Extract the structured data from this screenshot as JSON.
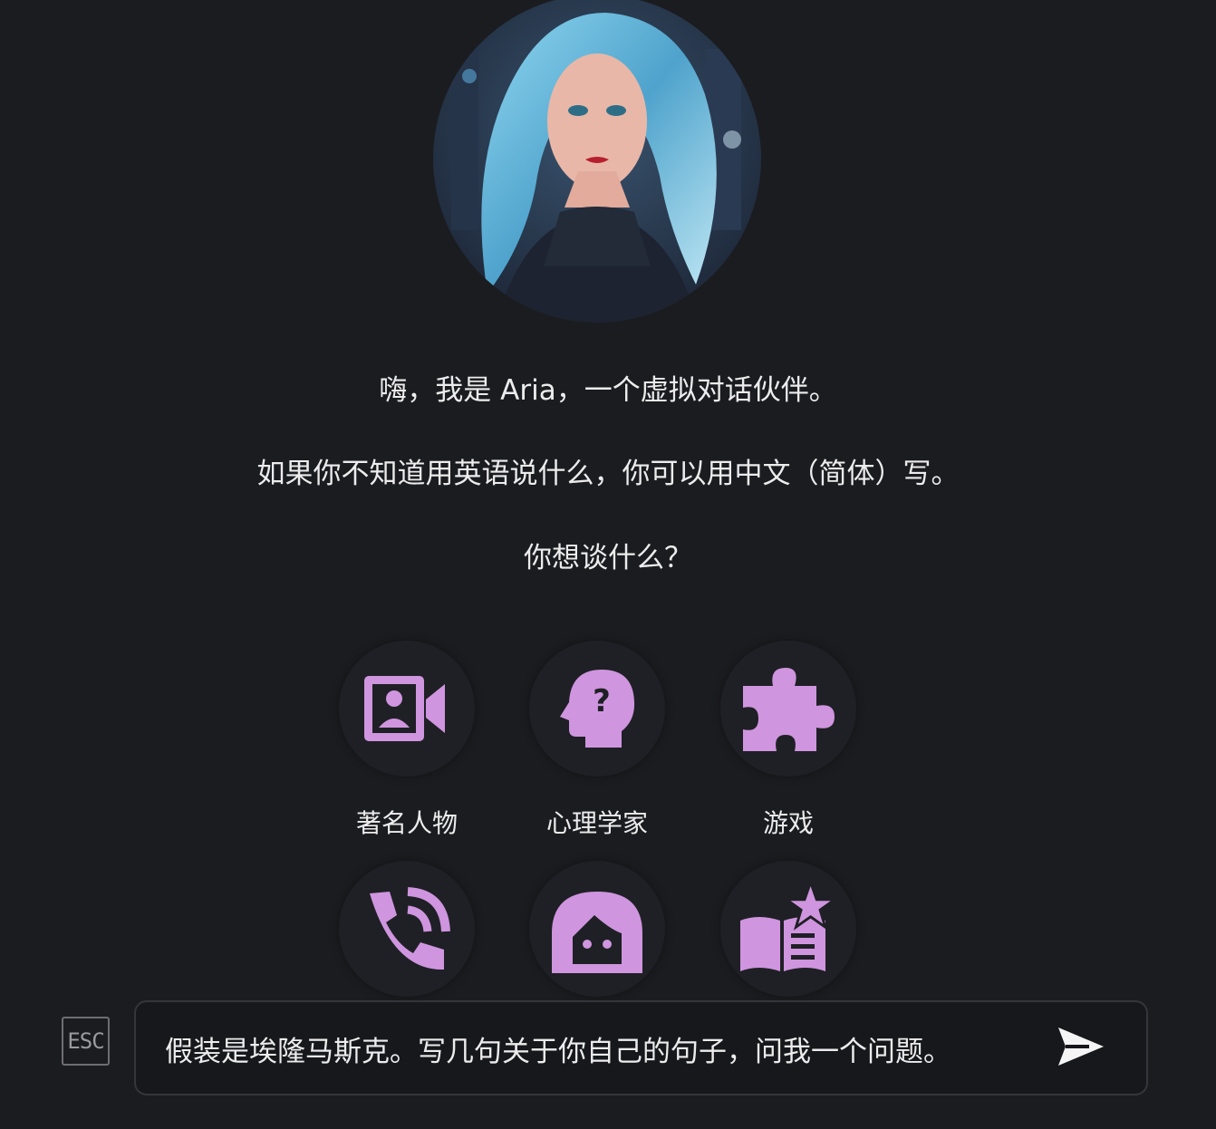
{
  "intro": {
    "greeting": "嗨，我是 Aria，一个虚拟对话伙伴。",
    "language_hint": "如果你不知道用英语说什么，你可以用中文（简体）写。",
    "question": "你想谈什么？"
  },
  "topics": [
    {
      "label": "著名人物",
      "icon": "contact-video-icon"
    },
    {
      "label": "心理学家",
      "icon": "head-question-icon"
    },
    {
      "label": "游戏",
      "icon": "puzzle-icon"
    },
    {
      "label": "",
      "icon": "phone-call-icon"
    },
    {
      "label": "",
      "icon": "girl-face-icon"
    },
    {
      "label": "",
      "icon": "story-book-star-icon"
    }
  ],
  "composer": {
    "esc_label": "ESC",
    "input_value": "假装是埃隆马斯克。写几句关于你自己的句子，问我一个问题。",
    "send_icon": "send-icon"
  },
  "colors": {
    "background": "#1b1c20",
    "accent_icon": "#cf95df",
    "text": "#ececec",
    "input_border": "#35363b"
  }
}
